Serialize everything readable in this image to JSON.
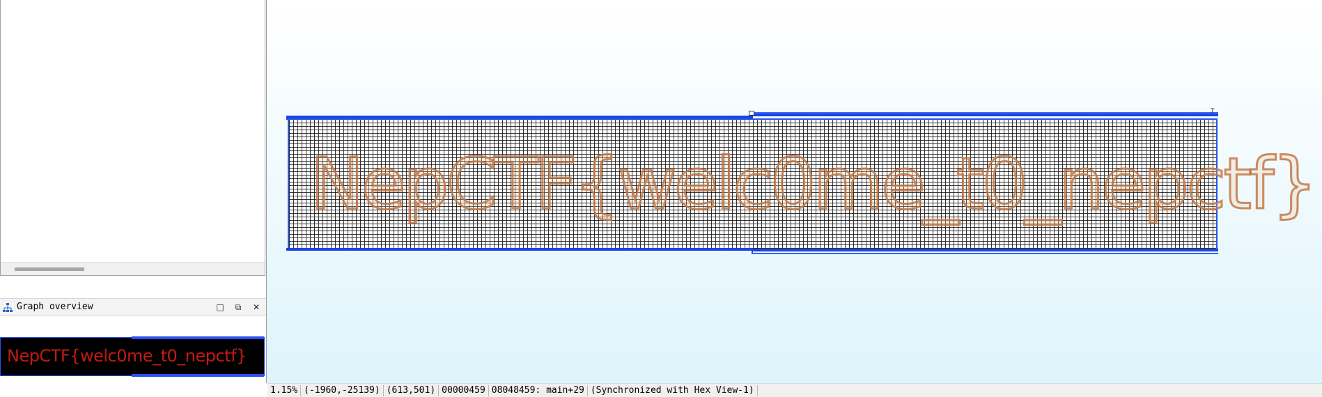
{
  "graph_overview": {
    "title": "Graph overview",
    "icon": "graph-overview-icon",
    "buttons": {
      "maximize": "□",
      "float": "⧉",
      "close": "✕"
    },
    "thumbnail_text": "NepCTF{welc0me_t0_nepctf}"
  },
  "graph": {
    "flag_text": "NepCTF{welc0me_t0_nepctf}"
  },
  "status_bar": {
    "zoom": "1.15%",
    "scroll_pos": "(-1960,-25139)",
    "cursor_pos": "(613,501)",
    "file_offset": "00000459",
    "address": "08048459: main+29",
    "sync": "(Synchronized with Hex View-1)"
  },
  "colors": {
    "graph_border": "#2456e6",
    "flag_red": "#c41a12",
    "graph_bg_bottom": "#def4fb"
  }
}
